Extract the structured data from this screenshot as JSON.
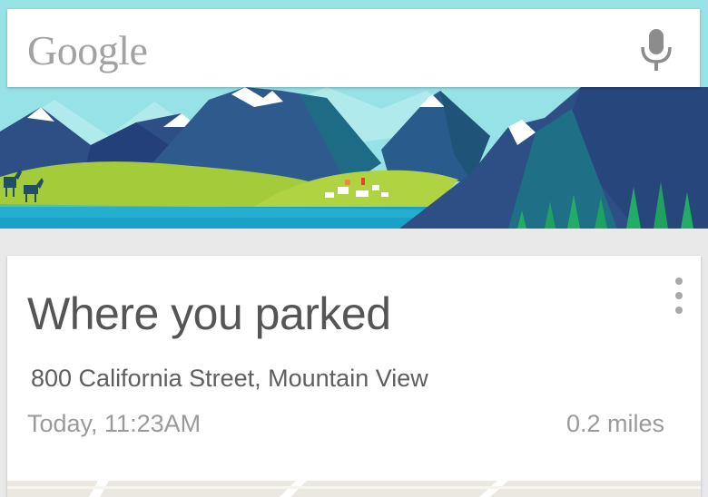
{
  "search": {
    "logo_text": "Google",
    "mic_icon": "microphone-icon"
  },
  "banner": {
    "illustration": "mountains-lake-deer-landscape",
    "colors": {
      "sky": "#8fe0e4",
      "mountain_dark": "#2f4e86",
      "mountain_teal": "#1f6f86",
      "meadow": "#a4cc3a",
      "lake": "#1aa2c4"
    }
  },
  "card": {
    "title": "Where you parked",
    "address": "800 California Street, Mountain View",
    "time": "Today, 11:23AM",
    "distance": "0.2 miles",
    "menu_icon": "more-vertical-icon"
  },
  "colors": {
    "background": "#e9e9e9",
    "card": "#ffffff",
    "title_text": "#555555",
    "secondary_text": "#9a9a9a"
  }
}
